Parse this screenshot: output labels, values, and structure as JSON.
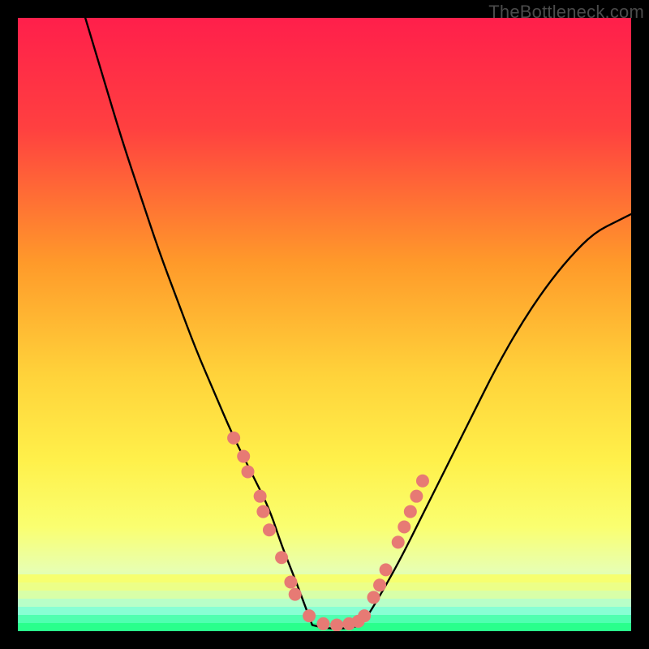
{
  "watermark": "TheBottleneck.com",
  "chart_data": {
    "type": "line",
    "title": "",
    "xlabel": "",
    "ylabel": "",
    "xlim": [
      0,
      100
    ],
    "ylim": [
      0,
      100
    ],
    "background_gradient": {
      "stops": [
        {
          "offset": 0,
          "color": "#ff1f4b"
        },
        {
          "offset": 18,
          "color": "#ff4040"
        },
        {
          "offset": 40,
          "color": "#ff9a2a"
        },
        {
          "offset": 58,
          "color": "#ffd23a"
        },
        {
          "offset": 72,
          "color": "#fff04a"
        },
        {
          "offset": 83,
          "color": "#faff70"
        },
        {
          "offset": 90,
          "color": "#e8ffb0"
        },
        {
          "offset": 95,
          "color": "#b8ffcc"
        },
        {
          "offset": 100,
          "color": "#2aff8c"
        }
      ],
      "bottom_band_colors": [
        "#f6ff70",
        "#ecff88",
        "#d8ffa8",
        "#b8ffc8",
        "#88ffd4",
        "#50ffb0",
        "#2aff8c"
      ]
    },
    "series": [
      {
        "name": "left-descent",
        "type": "line",
        "x": [
          11,
          14,
          17,
          20,
          23,
          26,
          29,
          32,
          35,
          38,
          41,
          43,
          45,
          46.5,
          48
        ],
        "y": [
          100,
          90,
          80,
          71,
          62,
          54,
          46,
          39,
          32,
          26,
          20,
          14,
          9,
          5,
          1
        ]
      },
      {
        "name": "valley-floor",
        "type": "line",
        "x": [
          48,
          50,
          52,
          54,
          56
        ],
        "y": [
          1,
          0.5,
          0.4,
          0.5,
          1
        ]
      },
      {
        "name": "right-ascent",
        "type": "line",
        "x": [
          56,
          58,
          62,
          66,
          70,
          74,
          78,
          82,
          86,
          90,
          94,
          98,
          100
        ],
        "y": [
          1,
          4,
          11,
          19,
          27,
          35,
          43,
          50,
          56,
          61,
          65,
          67,
          68
        ]
      }
    ],
    "markers": {
      "name": "highlight-dots",
      "color": "#e77a74",
      "radius_px": 8,
      "points": [
        {
          "x": 35.2,
          "y": 31.5
        },
        {
          "x": 36.8,
          "y": 28.5
        },
        {
          "x": 37.5,
          "y": 26.0
        },
        {
          "x": 39.5,
          "y": 22.0
        },
        {
          "x": 40.0,
          "y": 19.5
        },
        {
          "x": 41.0,
          "y": 16.5
        },
        {
          "x": 43.0,
          "y": 12.0
        },
        {
          "x": 44.5,
          "y": 8.0
        },
        {
          "x": 45.2,
          "y": 6.0
        },
        {
          "x": 47.5,
          "y": 2.5
        },
        {
          "x": 49.8,
          "y": 1.2
        },
        {
          "x": 52.0,
          "y": 1.0
        },
        {
          "x": 54.0,
          "y": 1.2
        },
        {
          "x": 55.5,
          "y": 1.6
        },
        {
          "x": 56.5,
          "y": 2.5
        },
        {
          "x": 58.0,
          "y": 5.5
        },
        {
          "x": 59.0,
          "y": 7.5
        },
        {
          "x": 60.0,
          "y": 10.0
        },
        {
          "x": 62.0,
          "y": 14.5
        },
        {
          "x": 63.0,
          "y": 17.0
        },
        {
          "x": 64.0,
          "y": 19.5
        },
        {
          "x": 65.0,
          "y": 22.0
        },
        {
          "x": 66.0,
          "y": 24.5
        }
      ]
    }
  }
}
